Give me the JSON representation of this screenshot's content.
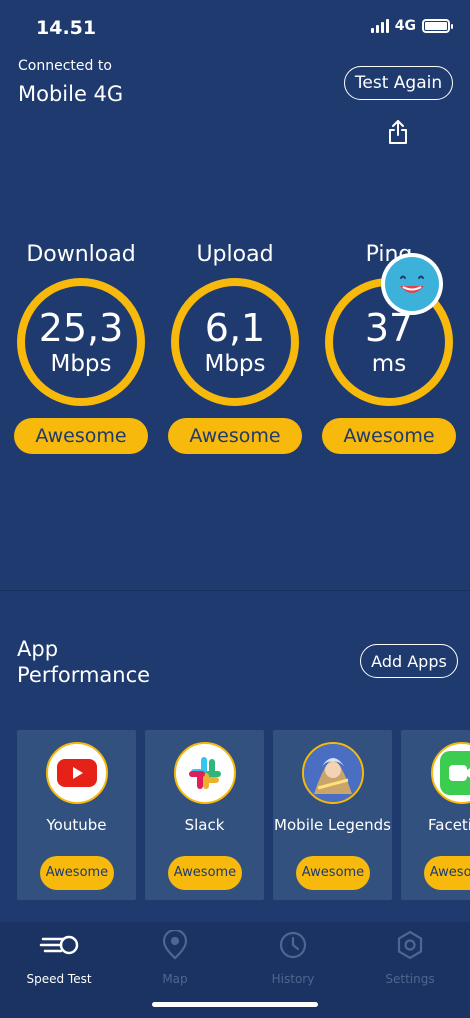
{
  "status_bar": {
    "time": "14.51",
    "network": "4G"
  },
  "connection": {
    "label": "Connected to",
    "name": "Mobile 4G"
  },
  "actions": {
    "test_again": "Test Again",
    "add_apps": "Add Apps"
  },
  "gauges": [
    {
      "title": "Download",
      "value": "25,3",
      "unit": "Mbps",
      "rating": "Awesome"
    },
    {
      "title": "Upload",
      "value": "6,1",
      "unit": "Mbps",
      "rating": "Awesome"
    },
    {
      "title": "Ping",
      "value": "37",
      "unit": "ms",
      "rating": "Awesome"
    }
  ],
  "app_performance": {
    "title_line1": "App",
    "title_line2": "Performance",
    "apps": [
      {
        "name": "Youtube",
        "rating": "Awesome",
        "icon": "youtube-icon"
      },
      {
        "name": "Slack",
        "rating": "Awesome",
        "icon": "slack-icon"
      },
      {
        "name": "Mobile Legends",
        "rating": "Awesome",
        "icon": "mobile-legends-icon"
      },
      {
        "name": "Facetime",
        "rating": "Awesome",
        "icon": "facetime-icon"
      }
    ]
  },
  "tabs": [
    {
      "label": "Speed Test",
      "icon": "speedometer-icon",
      "active": true
    },
    {
      "label": "Map",
      "icon": "map-pin-icon",
      "active": false
    },
    {
      "label": "History",
      "icon": "clock-icon",
      "active": false
    },
    {
      "label": "Settings",
      "icon": "gear-icon",
      "active": false
    }
  ],
  "colors": {
    "background": "#1f3a6e",
    "accent": "#f6b90c",
    "card": "#32517e",
    "tab_bar": "#1a3362"
  }
}
